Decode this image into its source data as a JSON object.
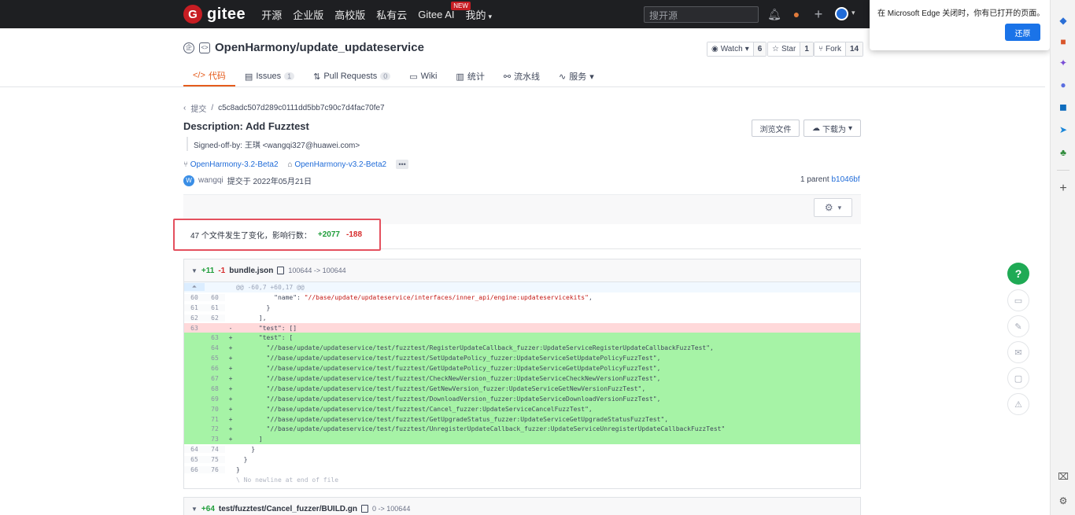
{
  "topnav": {
    "logo_text": "gitee",
    "logo_letter": "G",
    "items": [
      "开源",
      "企业版",
      "高校版",
      "私有云",
      "Gitee AI",
      "我的"
    ],
    "new_badge": "NEW",
    "search_placeholder": "搜开源"
  },
  "popup": {
    "message": "在 Microsoft Edge 关闭时，你有已打开的页面。",
    "restore_label": "还原"
  },
  "repo": {
    "name": "OpenHarmony/update_updateservice",
    "watch_label": "Watch",
    "watch_count": "6",
    "star_label": "Star",
    "star_count": "1",
    "fork_label": "Fork",
    "fork_count": "14"
  },
  "tabs": [
    {
      "label": "代码",
      "icon": "</>"
    },
    {
      "label": "Issues",
      "count": "1"
    },
    {
      "label": "Pull Requests",
      "count": "0"
    },
    {
      "label": "Wiki"
    },
    {
      "label": "统计"
    },
    {
      "label": "流水线"
    },
    {
      "label": "服务"
    }
  ],
  "commit": {
    "crumb_label": "提交",
    "crumb_sep": "/",
    "sha": "c5c8adc507d289c0111dd5bb7c90c7d4fac70fe7",
    "title": "Description: Add Fuzztest",
    "signed_off": "Signed-off-by: 王琪 <wangqi327@huawei.com>",
    "browse_label": "浏览文件",
    "download_label": "下载为",
    "branch": "OpenHarmony-3.2-Beta2",
    "tag": "OpenHarmony-v3.2-Beta2",
    "more": "•••",
    "author_initial": "W",
    "author": "wangqi",
    "commit_date": "提交于 2022年05月21日",
    "parent_prefix": "1 parent",
    "parent_sha": "b1046bf"
  },
  "stats": {
    "summary": "47 个文件发生了变化，影响行数：",
    "additions": "+2077",
    "deletions": "-188"
  },
  "file1": {
    "additions": "+11",
    "deletions": "-1",
    "name": "bundle.json",
    "mode": "100644 -> 100644",
    "rows": [
      {
        "type": "hunk",
        "old": "",
        "new": "",
        "sign": "",
        "code": "@@ -60,7 +60,17 @@"
      },
      {
        "type": "ctx",
        "old": "60",
        "new": "60",
        "sign": "",
        "code": "          \"name\": ",
        "str": "\"//base/update/updateservice/interfaces/inner_api/engine:updateservicekits\""
      },
      {
        "type": "ctx",
        "old": "61",
        "new": "61",
        "sign": "",
        "code": "        }"
      },
      {
        "type": "ctx",
        "old": "62",
        "new": "62",
        "sign": "",
        "code": "      ],"
      },
      {
        "type": "del",
        "old": "63",
        "new": "",
        "sign": "-",
        "code": "      \"test\": []"
      },
      {
        "type": "ins",
        "old": "",
        "new": "63",
        "sign": "+",
        "code": "      \"test\": ["
      },
      {
        "type": "ins",
        "old": "",
        "new": "64",
        "sign": "+",
        "code": "        \"//base/update/updateservice/test/fuzztest/RegisterUpdateCallback_fuzzer:UpdateServiceRegisterUpdateCallbackFuzzTest\","
      },
      {
        "type": "ins",
        "old": "",
        "new": "65",
        "sign": "+",
        "code": "        \"//base/update/updateservice/test/fuzztest/SetUpdatePolicy_fuzzer:UpdateServiceSetUpdatePolicyFuzzTest\","
      },
      {
        "type": "ins",
        "old": "",
        "new": "66",
        "sign": "+",
        "code": "        \"//base/update/updateservice/test/fuzztest/GetUpdatePolicy_fuzzer:UpdateServiceGetUpdatePolicyFuzzTest\","
      },
      {
        "type": "ins",
        "old": "",
        "new": "67",
        "sign": "+",
        "code": "        \"//base/update/updateservice/test/fuzztest/CheckNewVersion_fuzzer:UpdateServiceCheckNewVersionFuzzTest\","
      },
      {
        "type": "ins",
        "old": "",
        "new": "68",
        "sign": "+",
        "code": "        \"//base/update/updateservice/test/fuzztest/GetNewVersion_fuzzer:UpdateServiceGetNewVersionFuzzTest\","
      },
      {
        "type": "ins",
        "old": "",
        "new": "69",
        "sign": "+",
        "code": "        \"//base/update/updateservice/test/fuzztest/DownloadVersion_fuzzer:UpdateServiceDownloadVersionFuzzTest\","
      },
      {
        "type": "ins",
        "old": "",
        "new": "70",
        "sign": "+",
        "code": "        \"//base/update/updateservice/test/fuzztest/Cancel_fuzzer:UpdateServiceCancelFuzzTest\","
      },
      {
        "type": "ins",
        "old": "",
        "new": "71",
        "sign": "+",
        "code": "        \"//base/update/updateservice/test/fuzztest/GetUpgradeStatus_fuzzer:UpdateServiceGetUpgradeStatusFuzzTest\","
      },
      {
        "type": "ins",
        "old": "",
        "new": "72",
        "sign": "+",
        "code": "        \"//base/update/updateservice/test/fuzztest/UnregisterUpdateCallback_fuzzer:UpdateServiceUnregisterUpdateCallbackFuzzTest\""
      },
      {
        "type": "ins",
        "old": "",
        "new": "73",
        "sign": "+",
        "code": "      ]"
      },
      {
        "type": "ctx",
        "old": "64",
        "new": "74",
        "sign": "",
        "code": "    }"
      },
      {
        "type": "ctx",
        "old": "65",
        "new": "75",
        "sign": "",
        "code": "  }"
      },
      {
        "type": "ctx",
        "old": "66",
        "new": "76",
        "sign": "",
        "code": "}"
      },
      {
        "type": "nonl",
        "old": "",
        "new": "",
        "sign": "",
        "code": "\\ No newline at end of file"
      }
    ]
  },
  "file2": {
    "additions": "+64",
    "name": "test/fuzztest/Cancel_fuzzer/BUILD.gn",
    "mode": "0 -> 100644"
  },
  "help_label": "?",
  "colors": {
    "accent": "#e55c1c",
    "add": "#1f9d3a",
    "del": "#d72b2b",
    "brand": "#c71d23"
  }
}
